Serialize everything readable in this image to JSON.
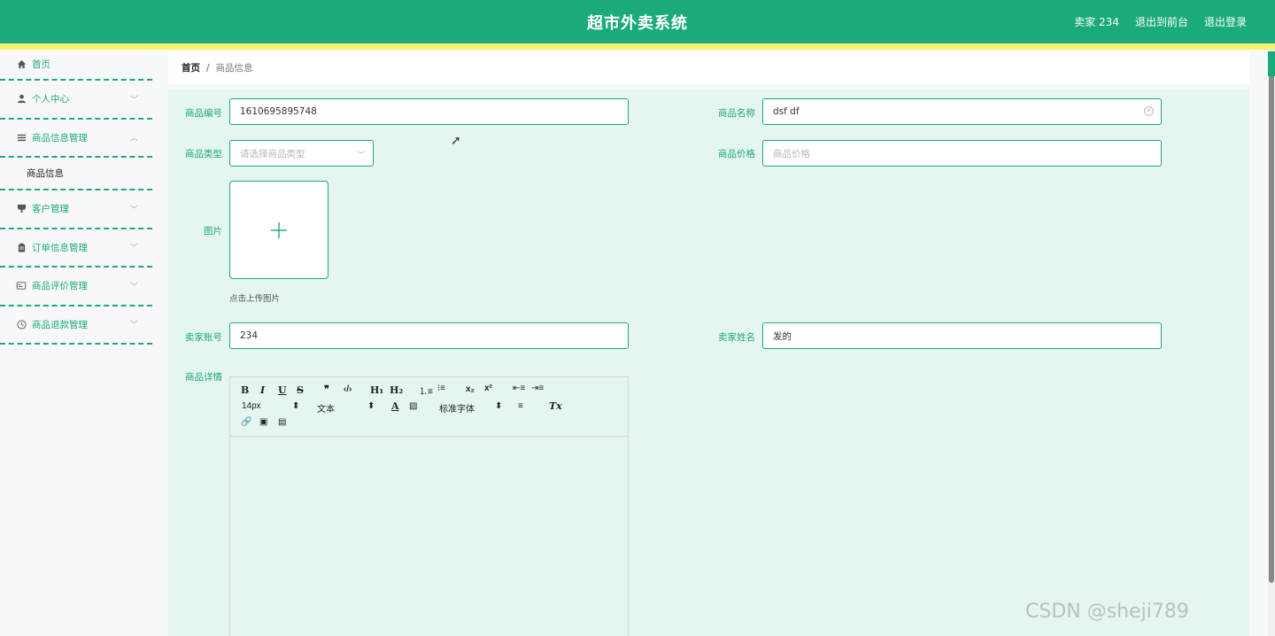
{
  "header": {
    "title": "超市外卖系统",
    "user": "卖家 234",
    "back_front": "退出到前台",
    "logout": "退出登录"
  },
  "sidebar": {
    "home": "首页",
    "items": [
      {
        "label": "个人中心",
        "icon": "user-icon"
      },
      {
        "label": "商品信息管理",
        "icon": "menu-icon"
      },
      {
        "label": "客户管理",
        "icon": "customer-icon"
      },
      {
        "label": "订单信息管理",
        "icon": "clipboard-icon"
      },
      {
        "label": "商品评价管理",
        "icon": "review-icon"
      },
      {
        "label": "商品退款管理",
        "icon": "clock-icon"
      }
    ],
    "submenu": "商品信息"
  },
  "breadcrumb": {
    "home": "首页",
    "separator": "/",
    "current": "商品信息"
  },
  "form": {
    "product_no_label": "商品编号",
    "product_no_value": "1610695895748",
    "product_name_label": "商品名称",
    "product_name_value": "dsf df",
    "product_type_label": "商品类型",
    "product_type_placeholder": "请选择商品类型",
    "product_price_label": "商品价格",
    "product_price_placeholder": "商品价格",
    "image_label": "图片",
    "upload_tip": "点击上传图片",
    "seller_account_label": "卖家账号",
    "seller_account_value": "234",
    "seller_name_label": "卖家姓名",
    "seller_name_value": "发的",
    "detail_label": "商品详情"
  },
  "editor": {
    "font_size": "14px",
    "text_type": "文本",
    "font_family": "标准字体"
  },
  "watermark": "CSDN @sheji789",
  "colors": {
    "primary": "#1aaa7c",
    "accent_bar": "#f5f36b",
    "content_bg": "#e5f5f0"
  }
}
